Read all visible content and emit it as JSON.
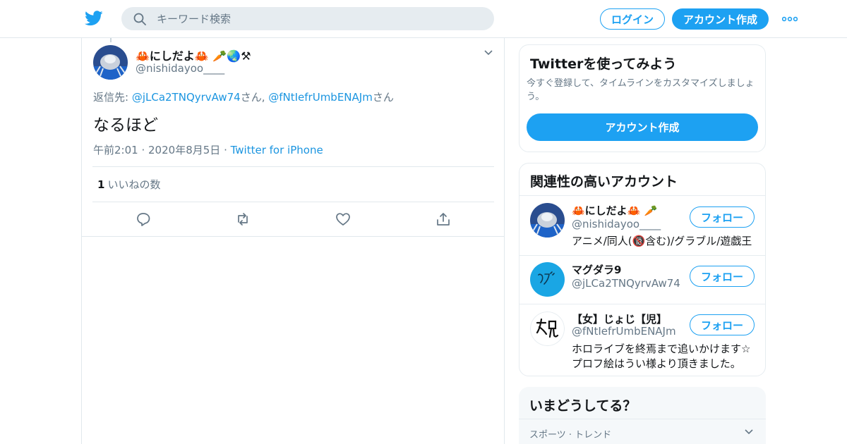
{
  "header": {
    "search_placeholder": "キーワード検索",
    "login_label": "ログイン",
    "signup_label": "アカウント作成"
  },
  "tweet": {
    "display_name": "🦀にしだよ🦀 🥕🌏⚒",
    "handle": "@nishidayoo____",
    "reply_prefix": "返信先: ",
    "reply_mention_1": "@jLCa2TNQyrvAw74",
    "reply_suffix_1": "さん, ",
    "reply_mention_2": "@fNtIefrUmbENAJm",
    "reply_suffix_2": "さん",
    "text": "なるほど",
    "time": "午前2:01",
    "date": "2020年8月5日",
    "source": "Twitter for iPhone",
    "like_count": "1",
    "like_label": "いいねの数"
  },
  "signup_card": {
    "title": "Twitterを使ってみよう",
    "description": "今すぐ登録して、タイムラインをカスタマイズしましょう。",
    "button_label": "アカウント作成"
  },
  "related": {
    "title": "関連性の高いアカウント",
    "follow_label": "フォロー",
    "accounts": [
      {
        "name": "🦀にしだよ🦀 🥕",
        "handle": "@nishidayoo____",
        "bio": "アニメ/同人(🔞含む)/グラブル/遊戯王"
      },
      {
        "name": "マグダラ9",
        "handle": "@jLCa2TNQyrvAw74",
        "bio": ""
      },
      {
        "name": "【女】じょじ【児】",
        "handle": "@fNtIefrUmbENAJm",
        "bio": "ホロライブを終焉まで追いかけます☆プロフ絵はうい様より頂きました。"
      }
    ]
  },
  "trends": {
    "title": "いまどうしてる？",
    "category": "スポーツ · トレンド"
  },
  "colors": {
    "accent": "#1da1f2",
    "link": "#1b95e0",
    "muted": "#657786"
  }
}
